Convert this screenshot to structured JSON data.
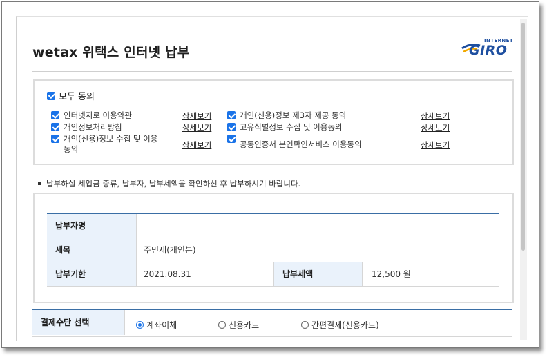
{
  "page": {
    "title": "wetax 위택스 인터넷 납부",
    "logo": {
      "top": "INTERNET",
      "main": "GIRO"
    }
  },
  "consent": {
    "all_label": "모두 동의",
    "left": [
      {
        "label": "인터넷지로 이용약관",
        "detail": "상세보기"
      },
      {
        "label": "개인정보처리방침",
        "detail": "상세보기"
      },
      {
        "label_line1": "개인(신용)정보 수집 및 이용",
        "label_line2": "동의",
        "detail": "상세보기"
      }
    ],
    "right": [
      {
        "label": "개인(신용)정보 제3자 제공 동의",
        "detail": "상세보기"
      },
      {
        "label": "고유식별정보 수집 및 이용동의",
        "detail": "상세보기"
      },
      {
        "label": "공동인증서 본인확인서비스 이용동의",
        "detail": "상세보기"
      }
    ]
  },
  "notice": "납부하실 세입금 종류, 납부자, 납부세액을 확인하신 후 납부하시기 바랍니다.",
  "info": {
    "payer_label": "납부자명",
    "payer_value": "",
    "tax_label": "세목",
    "tax_value": "주민세(개인분)",
    "due_label": "납부기한",
    "due_value": "2021.08.31",
    "amount_label": "납부세액",
    "amount_value": "12,500 원"
  },
  "payment": {
    "label": "결제수단 선택",
    "options": [
      "계좌이체",
      "신용카드",
      "간편결제(신용카드)"
    ],
    "selected": "계좌이체"
  },
  "colors": {
    "accent": "#1a73e8",
    "table_border": "#3a6ea5",
    "header_bg": "#eaf2fb",
    "logo": "#1e4fa0"
  }
}
